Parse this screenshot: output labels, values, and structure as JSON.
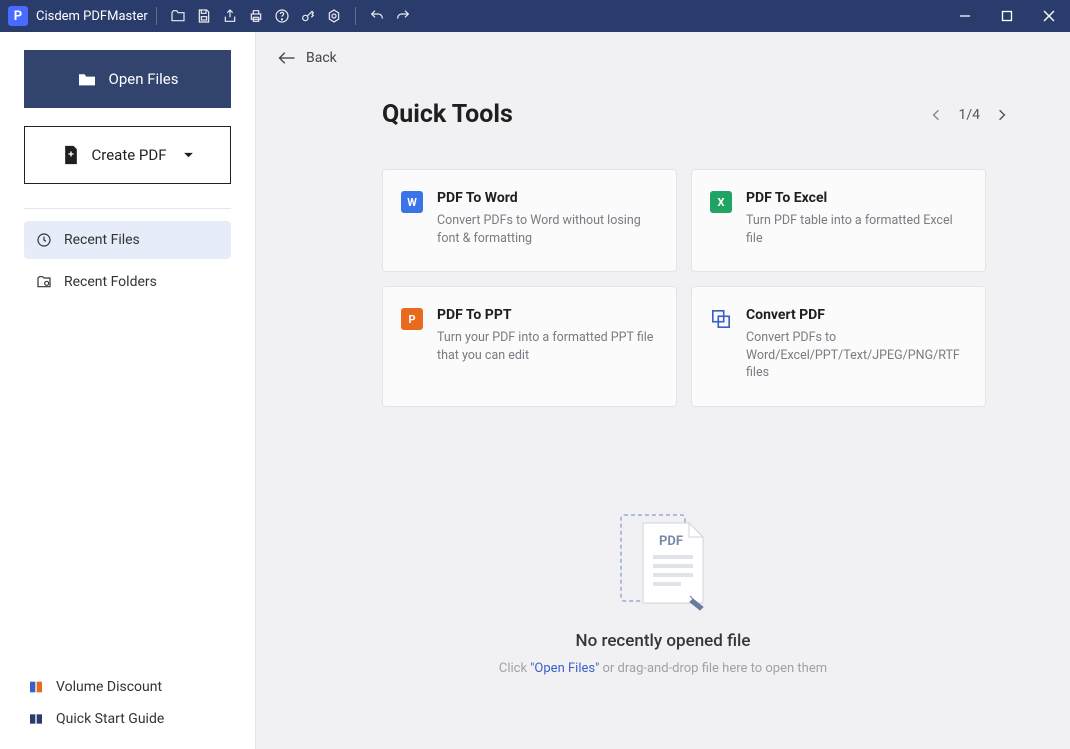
{
  "app": {
    "name": "Cisdem PDFMaster",
    "letter": "P"
  },
  "sidebar": {
    "open_label": "Open Files",
    "create_label": "Create PDF",
    "items": [
      {
        "label": "Recent Files"
      },
      {
        "label": "Recent Folders"
      }
    ],
    "footer": [
      {
        "label": "Volume Discount"
      },
      {
        "label": "Quick Start Guide"
      }
    ]
  },
  "main": {
    "back_label": "Back",
    "title": "Quick Tools",
    "page_indicator": "1/4",
    "cards": [
      {
        "title": "PDF To Word",
        "desc": "Convert PDFs to Word without losing font & formatting",
        "icon_color": "#3b73e8",
        "icon_letter": "W"
      },
      {
        "title": "PDF To Excel",
        "desc": "Turn PDF table into a formatted Excel file",
        "icon_color": "#1fa463",
        "icon_letter": "X"
      },
      {
        "title": "PDF To PPT",
        "desc": "Turn your PDF into a formatted PPT file that you can edit",
        "icon_color": "#e86a1f",
        "icon_letter": "P"
      },
      {
        "title": "Convert PDF",
        "desc": "Convert PDFs to Word/Excel/PPT/Text/JPEG/PNG/RTF files",
        "icon_color": "#3b5fc9",
        "icon_letter": ""
      }
    ],
    "empty": {
      "title": "No recently opened file",
      "sub_prefix": "Click ",
      "sub_link": "\"Open Files\"",
      "sub_suffix": " or drag-and-drop file here to open them"
    }
  }
}
